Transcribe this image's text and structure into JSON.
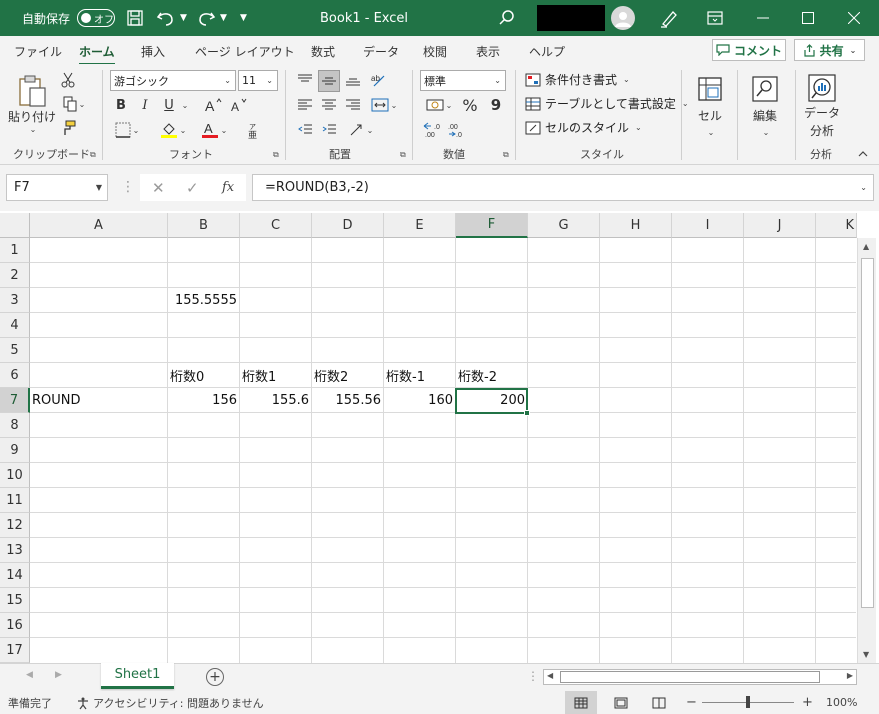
{
  "titlebar": {
    "autosave_label": "自動保存",
    "autosave_state": "オフ",
    "document_title": "Book1  -  Excel",
    "accent": "#217346"
  },
  "tabs": [
    {
      "label": "ファイル"
    },
    {
      "label": "ホーム",
      "active": true
    },
    {
      "label": "挿入"
    },
    {
      "label": "ページ レイアウト"
    },
    {
      "label": "数式"
    },
    {
      "label": "データ"
    },
    {
      "label": "校閲"
    },
    {
      "label": "表示"
    },
    {
      "label": "ヘルプ"
    }
  ],
  "header_buttons": {
    "comment": "コメント",
    "share": "共有"
  },
  "ribbon": {
    "clipboard": {
      "paste": "貼り付け",
      "group": "クリップボード"
    },
    "font": {
      "name": "游ゴシック",
      "size": "11",
      "bold": "B",
      "italic": "I",
      "underline": "U",
      "group": "フォント"
    },
    "alignment": {
      "group": "配置"
    },
    "number": {
      "format": "標準",
      "percent": "%",
      "comma": "9",
      "group": "数値"
    },
    "styles": {
      "conditional": "条件付き書式",
      "as_table": "テーブルとして書式設定",
      "cell_styles": "セルのスタイル",
      "group": "スタイル"
    },
    "cells": {
      "label": "セル"
    },
    "editing": {
      "label": "編集"
    },
    "analysis": {
      "label_line1": "データ",
      "label_line2": "分析",
      "group": "分析"
    }
  },
  "formula_bar": {
    "name_box": "F7",
    "formula": "=ROUND(B3,-2)"
  },
  "columns": [
    "A",
    "B",
    "C",
    "D",
    "E",
    "F",
    "G",
    "H",
    "I",
    "J",
    "K"
  ],
  "selected_column": "F",
  "rows": [
    "1",
    "2",
    "3",
    "4",
    "5",
    "6",
    "7",
    "8",
    "9",
    "10",
    "11",
    "12",
    "13",
    "14",
    "15",
    "16",
    "17"
  ],
  "selected_row": "7",
  "cells": {
    "B3": "155.5555",
    "B6": "桁数0",
    "C6": "桁数1",
    "D6": "桁数2",
    "E6": "桁数-1",
    "F6": "桁数-2",
    "A7": "ROUND",
    "B7": "156",
    "C7": "155.6",
    "D7": "155.56",
    "E7": "160",
    "F7": "200"
  },
  "sheet_tabs": [
    "Sheet1"
  ],
  "status": {
    "ready": "準備完了",
    "accessibility": "アクセシビリティ: 問題ありません",
    "zoom_minus": "−",
    "zoom_plus": "+",
    "zoom": "100%"
  }
}
